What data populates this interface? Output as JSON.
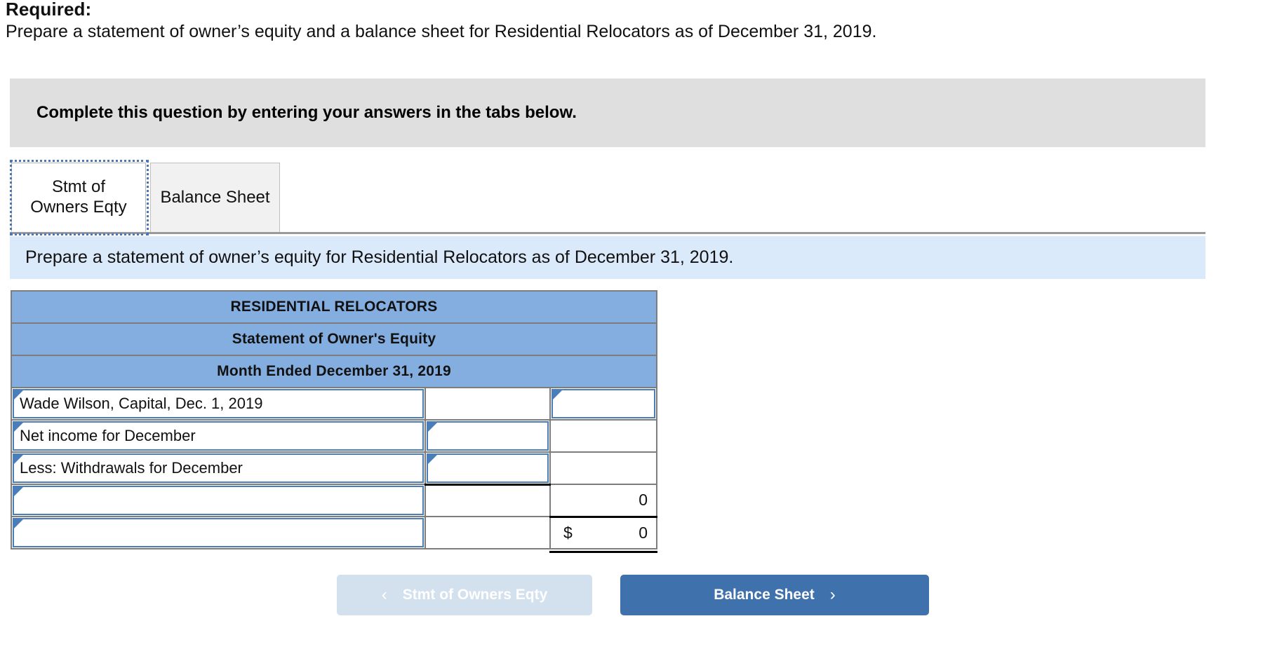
{
  "required": {
    "label": "Required:",
    "text": "Prepare a statement of owner’s equity and a balance sheet for Residential Relocators as of December 31, 2019."
  },
  "gray_banner": {
    "text": "Complete this question by entering your answers in the tabs below."
  },
  "tabs": [
    {
      "label_line1": "Stmt of",
      "label_line2": "Owners Eqty",
      "active": "true"
    },
    {
      "label_line1": "Balance Sheet",
      "label_line2": "",
      "active": "false"
    }
  ],
  "blue_bar": {
    "text": "Prepare a statement of owner’s equity for Residential Relocators as of December 31, 2019."
  },
  "sheet": {
    "headers": [
      "RESIDENTIAL RELOCATORS",
      "Statement of Owner's Equity",
      "Month Ended December 31, 2019"
    ],
    "rows": [
      {
        "label": "Wade Wilson, Capital, Dec. 1, 2019",
        "mid": "",
        "right": "",
        "right_dollar": ""
      },
      {
        "label": "Net income for December",
        "mid": "",
        "right": "",
        "right_dollar": ""
      },
      {
        "label": "Less: Withdrawals for December",
        "mid": "",
        "right": "",
        "right_dollar": ""
      },
      {
        "label": "",
        "mid": "",
        "right": "0",
        "right_dollar": ""
      },
      {
        "label": "",
        "mid": "",
        "right": "0",
        "right_dollar": "$"
      }
    ]
  },
  "buttons": {
    "prev_label": "Stmt of Owners Eqty",
    "prev_chevron": "‹",
    "next_label": "Balance Sheet",
    "next_chevron": "›"
  },
  "colors": {
    "header_blue": "#85AEE0",
    "input_border": "#4a7ebb",
    "banner_gray": "#dfdfdf",
    "bar_blue": "#dbeafa",
    "button_blue": "#3f72ad",
    "button_disabled": "#d3e0ee"
  }
}
